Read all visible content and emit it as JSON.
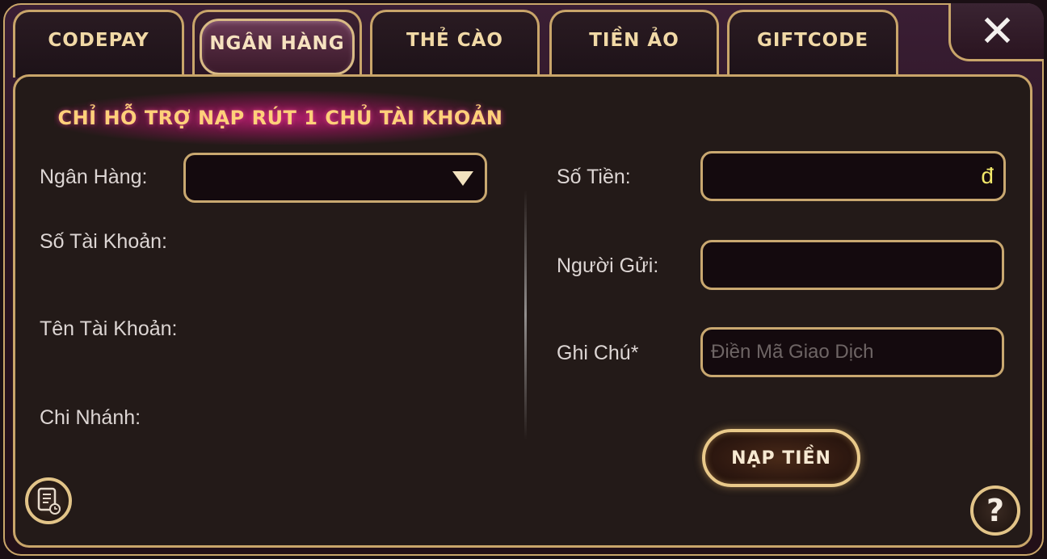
{
  "tabs": [
    {
      "label": "CODEPAY",
      "active": false
    },
    {
      "label": "NGÂN HÀNG",
      "active": true
    },
    {
      "label": "THẺ CÀO",
      "active": false
    },
    {
      "label": "TIỀN ẢO",
      "active": false
    },
    {
      "label": "GIFTCODE",
      "active": false
    }
  ],
  "close_glyph": "✕",
  "notice": "CHỈ HỖ TRỢ NẠP RÚT 1 CHỦ TÀI KHOẢN",
  "left_form": {
    "bank_label": "Ngân Hàng:",
    "bank_value": "",
    "account_number_label": "Số Tài Khoản:",
    "account_name_label": "Tên Tài Khoản:",
    "branch_label": "Chi Nhánh:"
  },
  "right_form": {
    "amount_label": "Số Tiền:",
    "amount_value": "",
    "currency_symbol": "đ",
    "sender_label": "Người Gửi:",
    "sender_value": "",
    "note_label": "Ghi Chú*",
    "note_placeholder": "Điền Mã Giao Dịch",
    "submit_label": "NẠP TIỀN"
  },
  "icons": {
    "history": "history-icon",
    "help": "?"
  },
  "colors": {
    "accent_gold": "#c9a56a",
    "notice_text": "#ffd07a",
    "currency": "#f3e96a"
  }
}
